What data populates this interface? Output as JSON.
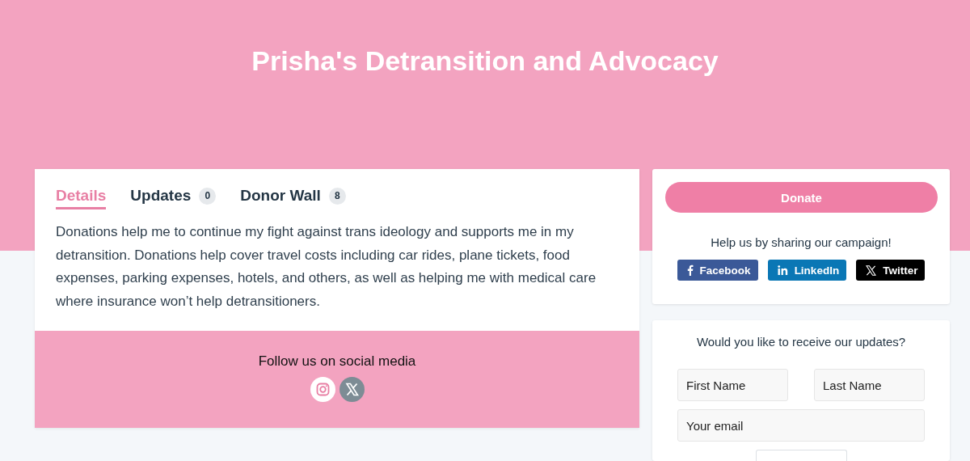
{
  "header": {
    "title": "Prisha's Detransition and Advocacy"
  },
  "tabs": [
    {
      "label": "Details",
      "selected": true
    },
    {
      "label": "Updates",
      "count": "0",
      "selected": false
    },
    {
      "label": "Donor Wall",
      "count": "8",
      "selected": false
    }
  ],
  "description": "Donations help me to continue my fight against trans ideology and supports me in my detransition. Donations help cover travel costs including car rides, plane tickets, food expenses, parking expenses, hotels, and others, as well as helping me with medical care where insurance won’t help detransitioners.",
  "social": {
    "heading": "Follow us on social media",
    "links": [
      {
        "kind": "camera"
      },
      {
        "kind": "x"
      }
    ]
  },
  "donate": {
    "label": "Donate"
  },
  "share": {
    "heading": "Help us by sharing our campaign!",
    "buttons": [
      {
        "kind": "facebook",
        "label": "Facebook",
        "color": "#3b5998"
      },
      {
        "kind": "linkedin",
        "label": "LinkedIn",
        "color": "#0a77b5"
      },
      {
        "kind": "x",
        "label": "Twitter",
        "color": "#000000"
      }
    ]
  },
  "signup": {
    "heading": "Would you like to receive our updates?",
    "first_name": {
      "placeholder": "First Name"
    },
    "last_name": {
      "placeholder": "Last Name"
    },
    "email": {
      "placeholder": "Your email"
    }
  }
}
